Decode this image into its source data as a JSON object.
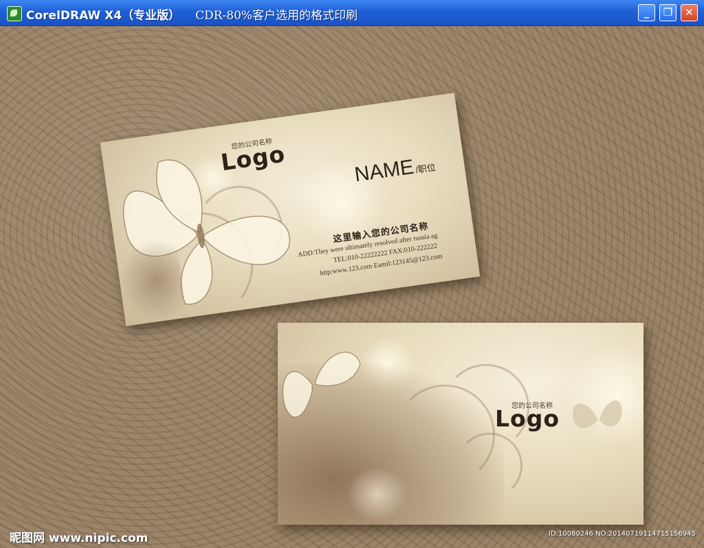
{
  "window": {
    "title": "CorelDRAW X4（专业版）",
    "subtitle": "CDR-80%客户选用的格式印刷",
    "buttons": {
      "minimize": "_",
      "maximize": "❐",
      "close": "✕"
    }
  },
  "card_front": {
    "company_small": "您的公司名称",
    "logo": "Logo",
    "name": "NAME",
    "position": "/职位",
    "company_prompt": "这里输入您的公司名称",
    "address": "ADD:They were ultimately resolved after russia ag",
    "phone": "TEL:010-22222222  FAX:010-222222",
    "web": "http:www.123.com Eamil:123145@123.com"
  },
  "card_back": {
    "company_small": "您的公司名称",
    "logo": "Logo"
  },
  "watermark": {
    "site": "昵图网 www.nipic.com",
    "id": "ID:10080246 NO:20140719114715156945"
  },
  "colors": {
    "titlebar": "#1f5fd6",
    "sand": "#9b8469",
    "card": "#e8dcbf",
    "ink": "#2b2218"
  }
}
